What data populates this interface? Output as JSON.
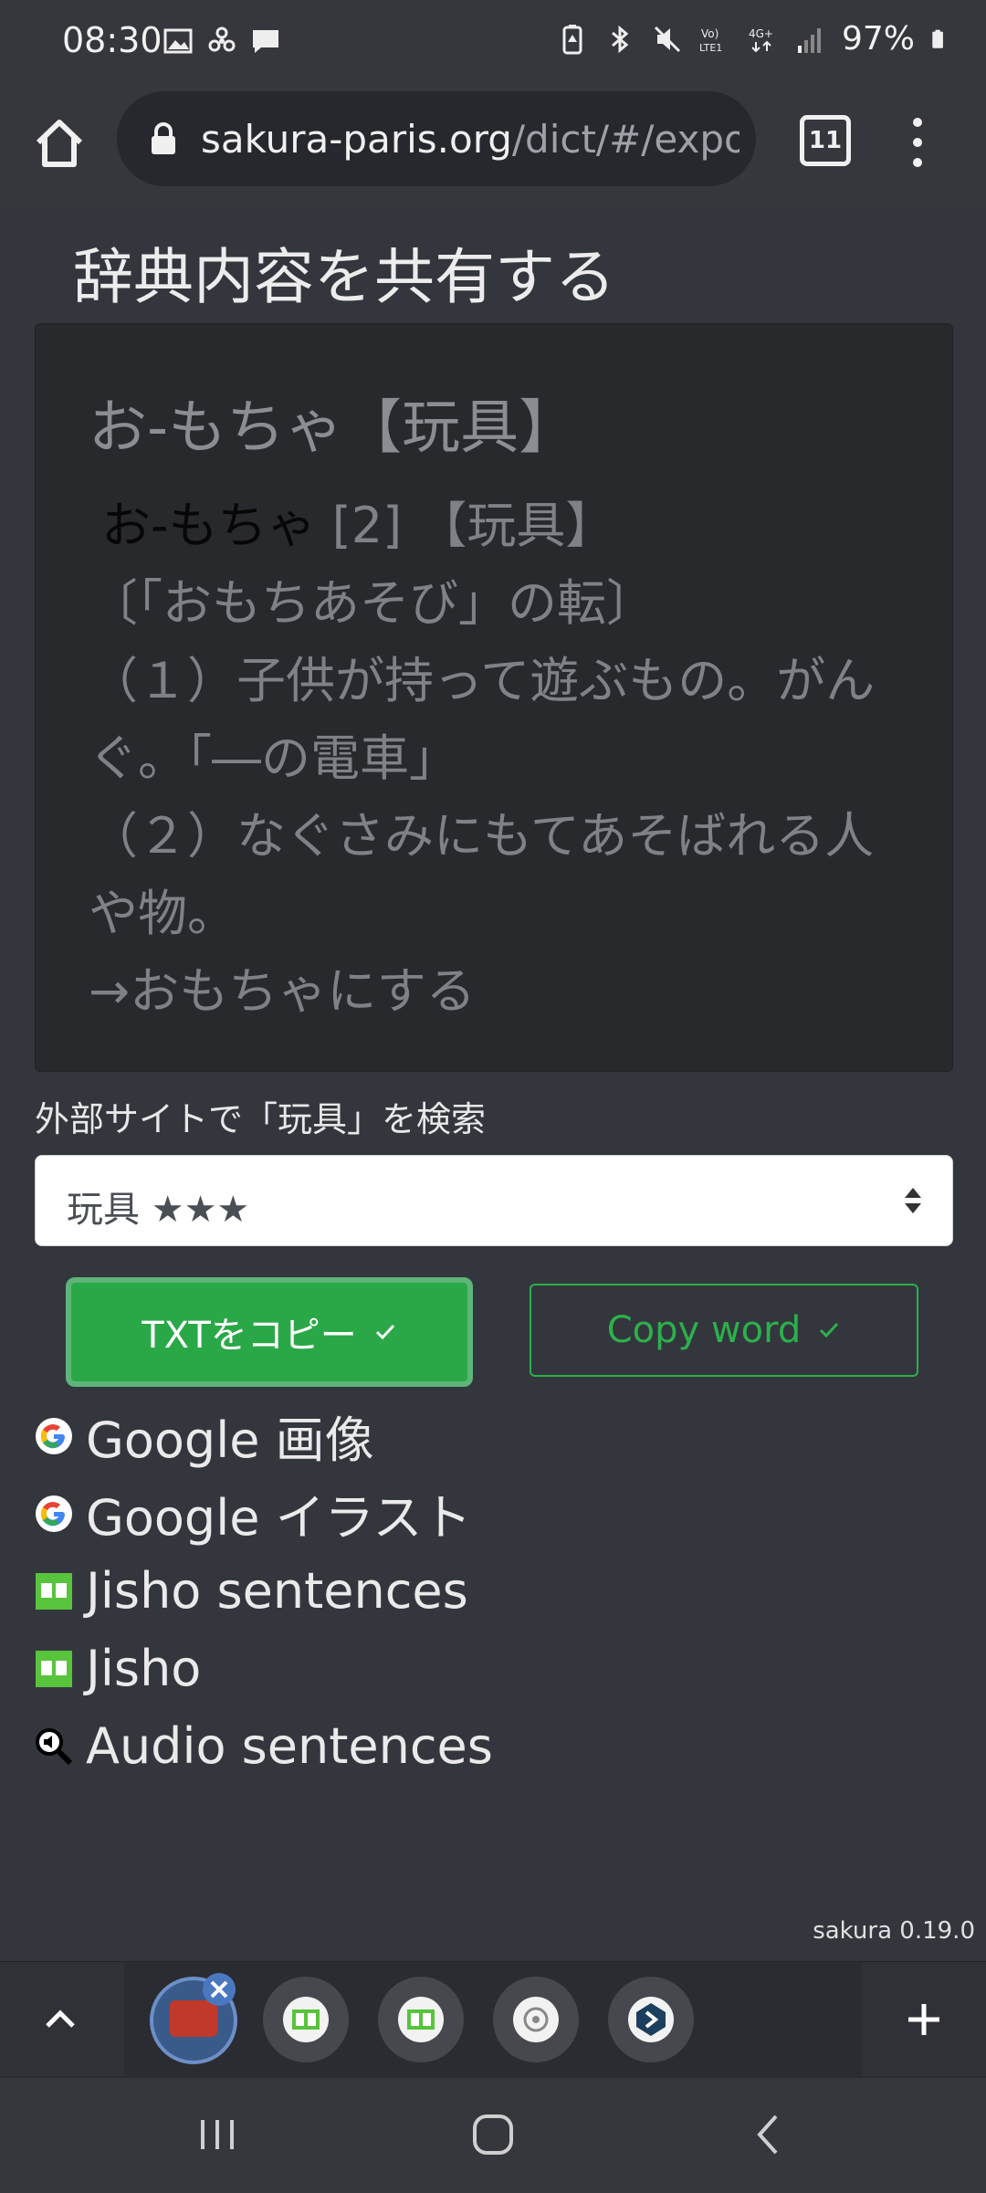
{
  "status_bar": {
    "time": "08:30",
    "battery": "97%"
  },
  "browser": {
    "url_host": "sakura-paris.org",
    "url_path": "/dict/#/export/",
    "tab_count": "11"
  },
  "page": {
    "title": "辞典内容を共有する",
    "entry": {
      "heading": "お-もちゃ【玩具】",
      "headword": "お-もちゃ",
      "accent_and_kanji": " [2] 【玩具】",
      "etymology": "〔「おもちあそび」の転〕",
      "sense1": "（１）子供が持って遊ぶもの。がんぐ。「―の電車」",
      "sense2": "（２）なぐさみにもてあそばれる人や物。",
      "crossref": "→おもちゃにする"
    },
    "external_label": "外部サイトで「玩具」を検索",
    "select_value": "玩具 ★★★",
    "copy_txt_button": "TXTをコピー",
    "copy_word_button": "Copy word",
    "links": [
      {
        "label": "Google 画像",
        "icon": "google-icon"
      },
      {
        "label": "Google イラスト",
        "icon": "google-icon"
      },
      {
        "label": "Jisho sentences",
        "icon": "jisho-icon"
      },
      {
        "label": "Jisho",
        "icon": "jisho-icon"
      },
      {
        "label": "Audio sentences",
        "icon": "audio-search-icon"
      }
    ],
    "version": "sakura 0.19.0"
  },
  "colors": {
    "accent_green": "#2aa847",
    "background": "#34363d",
    "entry_box": "#27292d"
  }
}
